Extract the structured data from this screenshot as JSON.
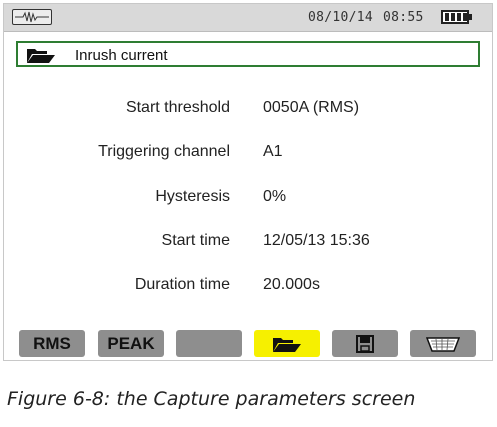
{
  "statusbar": {
    "date": "08/10/14",
    "time": "08:55",
    "left_icon": "waveform-icon",
    "right_icon": "battery-full-icon"
  },
  "title": {
    "icon": "open-folder-icon",
    "text": "Inrush current"
  },
  "parameters": [
    {
      "label": "Start threshold",
      "value": "0050A (RMS)"
    },
    {
      "label": "Triggering channel",
      "value": "A1"
    },
    {
      "label": "Hysteresis",
      "value": "0%"
    },
    {
      "label": "Start time",
      "value": "12/05/13 15:36"
    },
    {
      "label": "Duration time",
      "value": "20.000s"
    }
  ],
  "buttons": {
    "rms": "RMS",
    "peak": "PEAK",
    "blank_icon": "",
    "open_icon": "open-folder-icon",
    "save_icon": "floppy-disk-icon",
    "trash_icon": "trash-bin-icon"
  },
  "colors": {
    "active_button": "#f6f000",
    "button": "#8e8e8e",
    "title_border": "#2e7d32",
    "status_bar": "#d9d9d9"
  },
  "caption": "Figure 6-8: the Capture parameters screen"
}
